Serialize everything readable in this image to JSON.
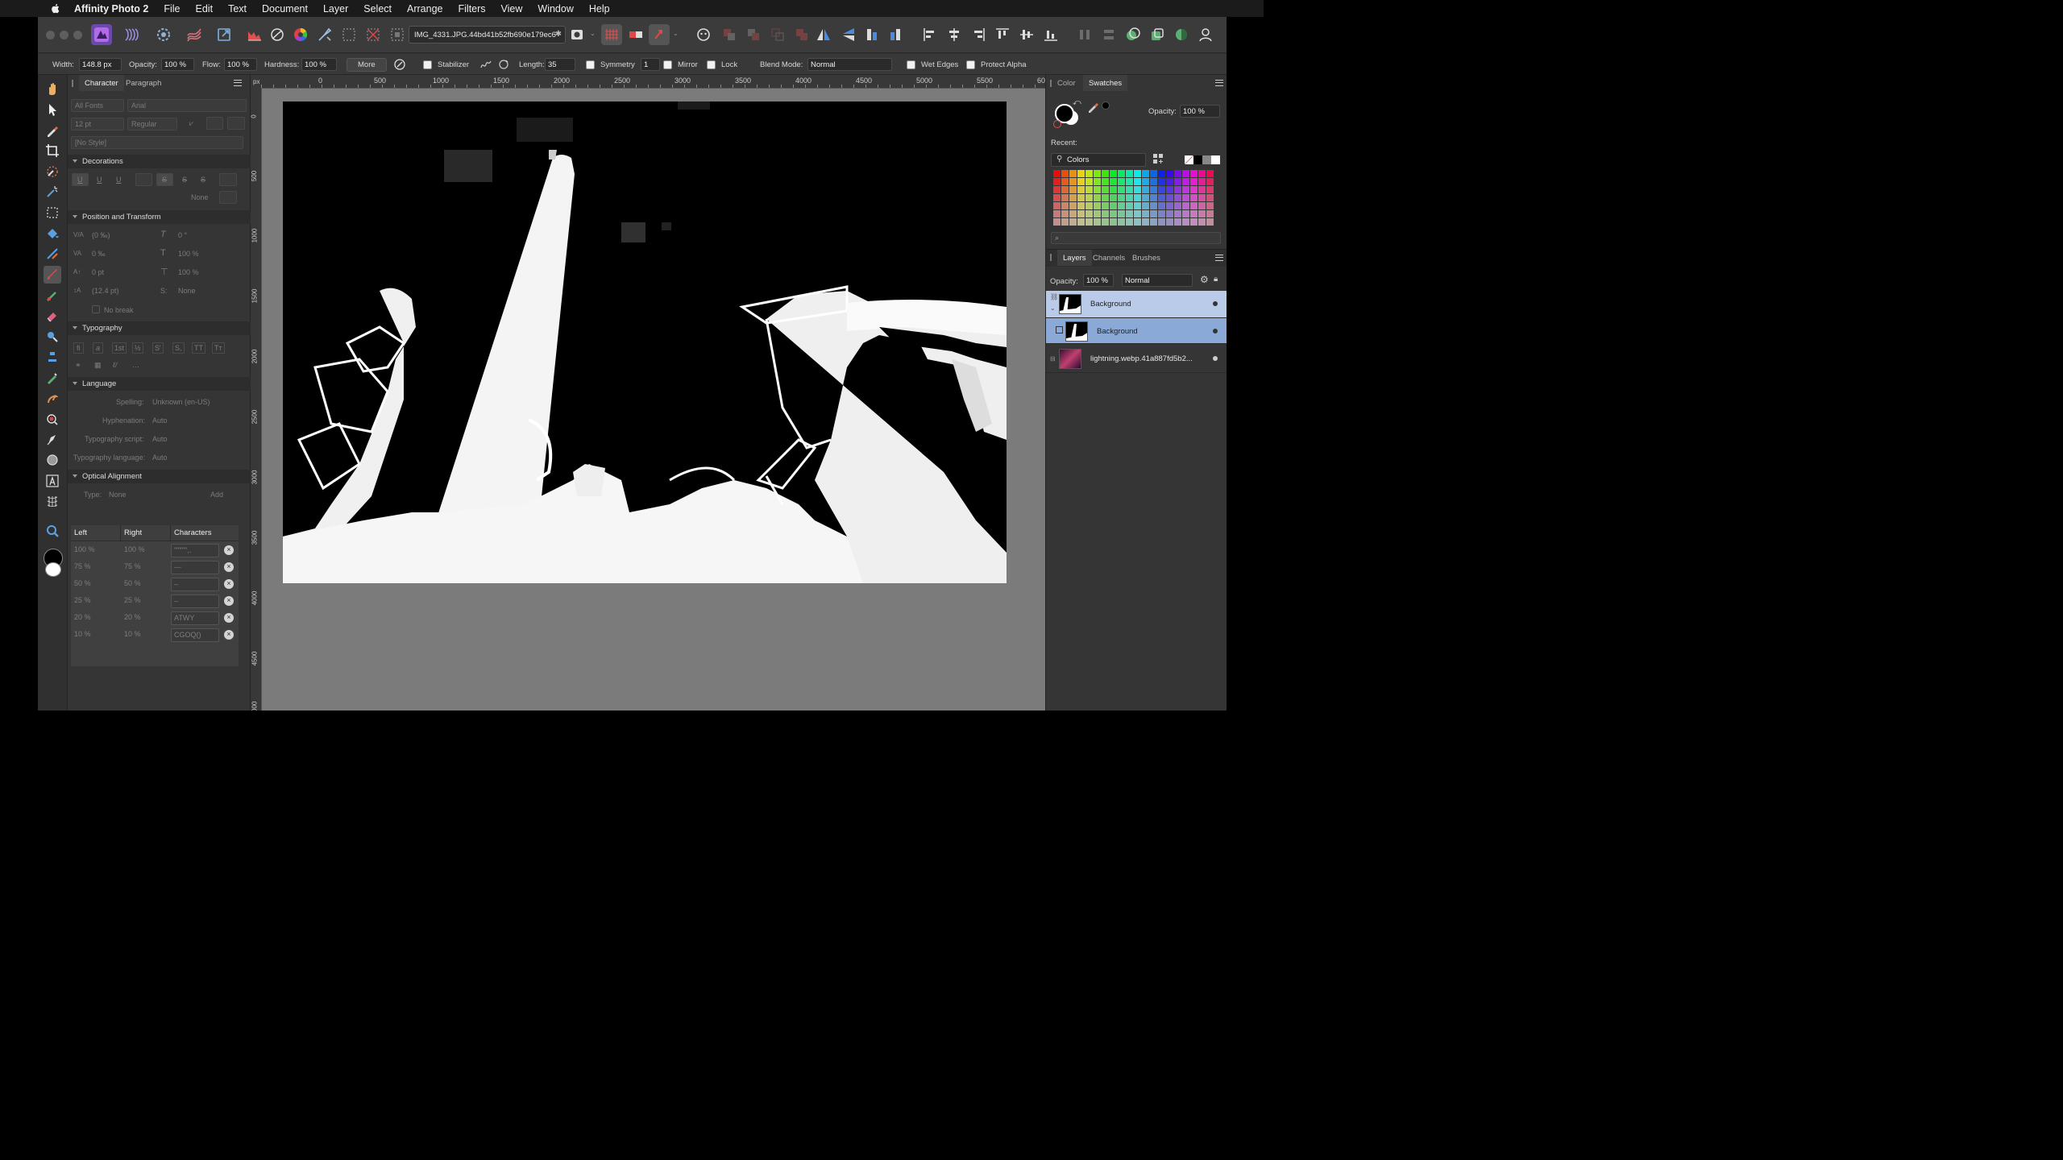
{
  "menubar": {
    "app_name": "Affinity Photo 2",
    "items": [
      "File",
      "Edit",
      "Text",
      "Document",
      "Layer",
      "Select",
      "Arrange",
      "Filters",
      "View",
      "Window",
      "Help"
    ]
  },
  "toolbar": {
    "document_tab": "IMG_4331.JPG.44bd41b52fb690e179ec6",
    "personas": [
      "photo-persona-icon",
      "liquify-persona-icon",
      "develop-persona-icon",
      "tone-mapping-persona-icon",
      "export-persona-icon"
    ]
  },
  "context_toolbar": {
    "width_label": "Width:",
    "width_value": "148.8 px",
    "opacity_label": "Opacity:",
    "opacity_value": "100 %",
    "flow_label": "Flow:",
    "flow_value": "100 %",
    "hardness_label": "Hardness:",
    "hardness_value": "100 %",
    "more_label": "More",
    "stabilizer_label": "Stabilizer",
    "length_label": "Length:",
    "length_value": "35",
    "symmetry_label": "Symmetry",
    "symmetry_value": "1",
    "mirror_label": "Mirror",
    "lock_label": "Lock",
    "blend_mode_label": "Blend Mode:",
    "blend_mode_value": "Normal",
    "wet_edges_label": "Wet Edges",
    "protect_alpha_label": "Protect Alpha"
  },
  "character_panel": {
    "tabs": [
      "Character",
      "Paragraph"
    ],
    "font_collection": "All Fonts",
    "font_family": "Arial",
    "font_size": "12 pt",
    "font_style": "Regular",
    "style": "[No Style]",
    "sections": {
      "decorations": "Decorations",
      "position_transform": "Position and Transform",
      "typography": "Typography",
      "language": "Language",
      "optical_alignment": "Optical Alignment"
    },
    "decorations_none": "None",
    "position": {
      "tracking": "(0 ‰)",
      "shear": "0 °",
      "kerning": "0 ‰",
      "scale_v": "100 %",
      "baseline": "0 pt",
      "scale_h": "100 %",
      "leading": "(12.4 pt)",
      "caps": "None",
      "no_break": "No break"
    },
    "language": {
      "spelling_label": "Spelling:",
      "spelling_value": "Unknown (en-US)",
      "hyphenation_label": "Hyphenation:",
      "hyphenation_value": "Auto",
      "script_label": "Typography script:",
      "script_value": "Auto",
      "lang_label": "Typography language:",
      "lang_value": "Auto"
    },
    "optical": {
      "type_label": "Type:",
      "type_value": "None",
      "add_label": "Add",
      "headers": [
        "Left",
        "Right",
        "Characters"
      ],
      "rows": [
        {
          "left": "100 %",
          "right": "100 %",
          "chars": "\"\"\"'''',."
        },
        {
          "left": "75 %",
          "right": "75 %",
          "chars": "---"
        },
        {
          "left": "50 %",
          "right": "50 %",
          "chars": "–"
        },
        {
          "left": "25 %",
          "right": "25 %",
          "chars": "–"
        },
        {
          "left": "20 %",
          "right": "20 %",
          "chars": "ATWY"
        },
        {
          "left": "10 %",
          "right": "10 %",
          "chars": "CGOQ()"
        }
      ]
    }
  },
  "rulers": {
    "unit": "px",
    "horizontal": [
      "0",
      "500",
      "1000",
      "1500",
      "2000",
      "2500",
      "3000",
      "3500",
      "4000",
      "4500",
      "5000",
      "5500",
      "6000"
    ],
    "vertical": [
      "0",
      "500",
      "1000",
      "1500",
      "2000",
      "2500",
      "3000",
      "3500",
      "4000",
      "4500",
      "5000"
    ]
  },
  "right_panel": {
    "top_tabs": [
      "Color",
      "Swatches"
    ],
    "opacity_label": "Opacity:",
    "opacity_value": "100 %",
    "recent_label": "Recent:",
    "palette_name": "Colors",
    "layer_tabs": [
      "Layers",
      "Channels",
      "Brushes"
    ],
    "layers_opacity_label": "Opacity:",
    "layers_opacity_value": "100 %",
    "layers_blend": "Normal",
    "layers": [
      {
        "name": "Background",
        "selected": false,
        "sub": true
      },
      {
        "name": "Background",
        "selected": true,
        "sub": false
      },
      {
        "name": "lightning.webp.41a887fd5b2...",
        "selected": false,
        "sub": false
      }
    ]
  },
  "colors": {
    "accent": "#4a7ab8",
    "layer_selected": "#8aa9d6",
    "layer_highlight": "#b9cbe8"
  }
}
